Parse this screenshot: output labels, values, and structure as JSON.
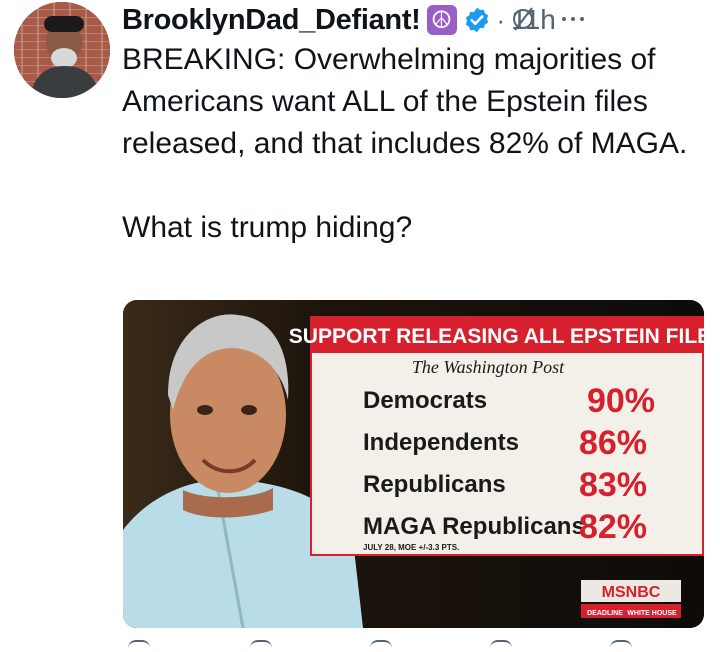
{
  "author": {
    "display_name": "BrooklynDad_Defiant!",
    "badge_emoji": "☮",
    "verified": true,
    "time_separator": "·",
    "timestamp": "11h"
  },
  "tweet": {
    "text": "BREAKING: Overwhelming majorities of Americans want ALL of the Epstein files released, and that includes 82% of MAGA.\n\nWhat is trump hiding?"
  },
  "media": {
    "banner": "SUPPORT RELEASING ALL EPSTEIN FILES",
    "source": "The Washington Post",
    "rows": [
      {
        "group": "Democrats",
        "value": "90%"
      },
      {
        "group": "Independents",
        "value": "86%"
      },
      {
        "group": "Republicans",
        "value": "83%"
      },
      {
        "group": "MAGA Republicans",
        "value": "82%"
      }
    ],
    "footnote": "JULY 28, MOE +/-3.3 PTS.",
    "network": "MSNBC",
    "show_left": "DEADLINE",
    "show_right": "WHITE HOUSE"
  },
  "colors": {
    "accent_red": "#d6202e",
    "verified_blue": "#1d9bf0",
    "peace_purple": "#9a5fc7",
    "muted": "#536471"
  },
  "icons": [
    "peace-emoji-icon",
    "verified-badge-icon",
    "grok-icon",
    "more-options-icon"
  ]
}
